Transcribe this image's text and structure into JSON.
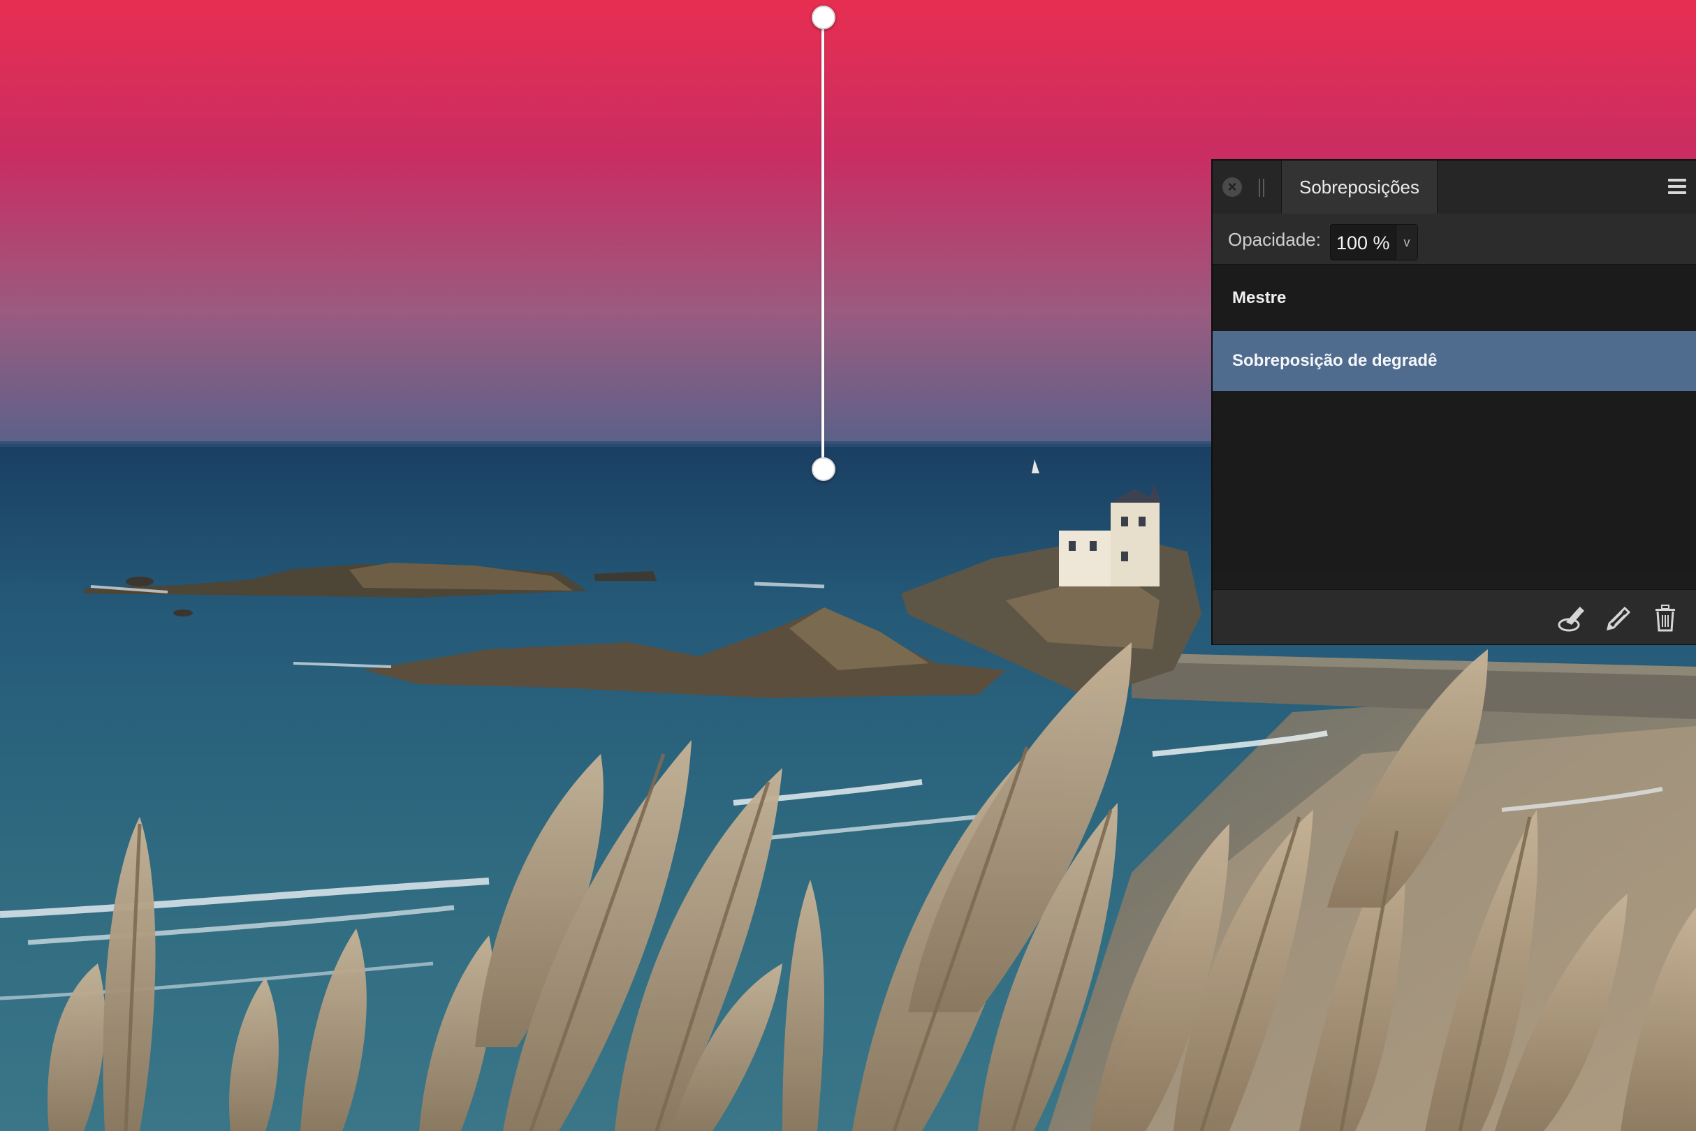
{
  "panel": {
    "tab_title": "Sobreposições",
    "opacity": {
      "label": "Opacidade:",
      "value": "100 %",
      "dropdown_glyph": "v"
    },
    "items": [
      {
        "label": "Mestre",
        "selected": false
      },
      {
        "label": "Sobreposição de degradê",
        "selected": true
      }
    ],
    "footer_icons": [
      "brush-erase-icon",
      "pencil-icon",
      "trash-icon"
    ],
    "close_icon": "close-icon",
    "menu_icon": "hamburger-menu-icon",
    "selection_color": "#4f6b8e"
  },
  "overlay": {
    "gradient_colors": [
      "#e62e53",
      "#c92d63",
      "#9a5a80",
      "#5b6288"
    ]
  }
}
